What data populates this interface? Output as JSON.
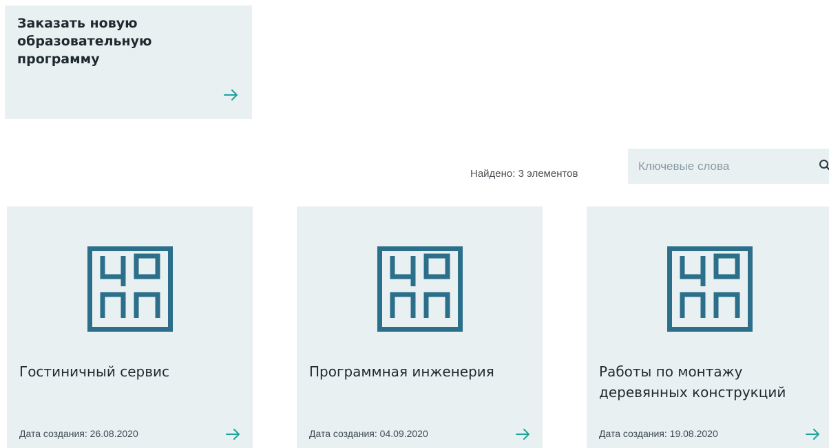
{
  "order_card": {
    "title": "Заказать новую образовательную программу",
    "arrow_icon": "arrow-right-icon"
  },
  "results": {
    "found_text": "Найдено: 3 элементов"
  },
  "search": {
    "placeholder": "Ключевые слова",
    "value": "",
    "icon": "search-icon"
  },
  "programs": [
    {
      "title": "Гостиничный сервис",
      "date_label": "Дата создания:",
      "date": "26.08.2020",
      "logo_icon": "copp-logo-icon"
    },
    {
      "title": "Программная инженерия",
      "date_label": "Дата создания:",
      "date": "04.09.2020",
      "logo_icon": "copp-logo-icon"
    },
    {
      "title": "Работы по монтажу деревянных конструкций",
      "date_label": "Дата создания:",
      "date": "19.08.2020",
      "logo_icon": "copp-logo-icon"
    }
  ],
  "colors": {
    "card_background": "#e8f0f2",
    "accent_teal": "#1aa39a",
    "logo_blue": "#2b6f8a"
  }
}
